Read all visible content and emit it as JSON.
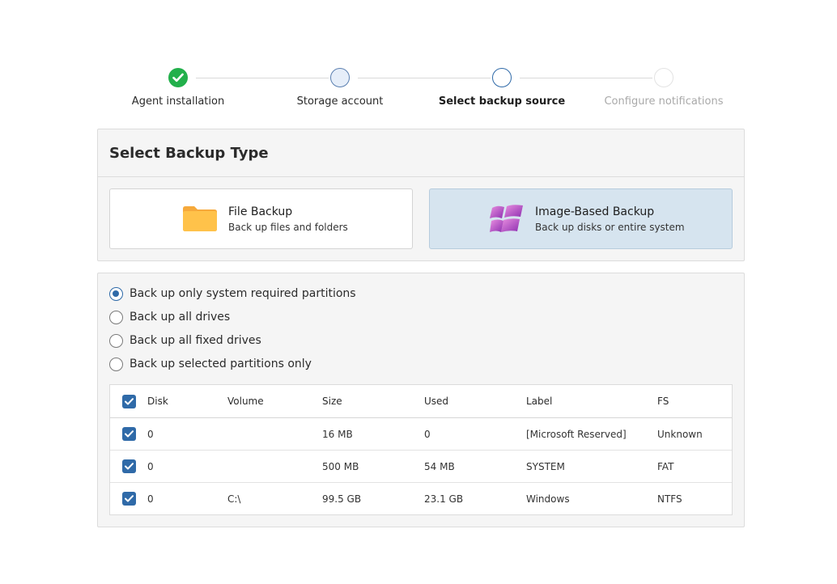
{
  "stepper": {
    "steps": [
      {
        "label": "Agent installation",
        "state": "done"
      },
      {
        "label": "Storage account",
        "state": "visited"
      },
      {
        "label": "Select backup source",
        "state": "current"
      },
      {
        "label": "Configure notifications",
        "state": "pending"
      }
    ]
  },
  "backup_type": {
    "title": "Select Backup Type",
    "options": [
      {
        "title": "File Backup",
        "description": "Back up files and folders",
        "icon": "folder-icon",
        "selected": false
      },
      {
        "title": "Image-Based Backup",
        "description": "Back up disks or entire system",
        "icon": "windows-logo-icon",
        "selected": true
      }
    ]
  },
  "partition_options": [
    {
      "label": "Back up only system required partitions",
      "selected": true
    },
    {
      "label": "Back up all drives",
      "selected": false
    },
    {
      "label": "Back up all fixed drives",
      "selected": false
    },
    {
      "label": "Back up selected partitions only",
      "selected": false
    }
  ],
  "table": {
    "columns": [
      "Disk",
      "Volume",
      "Size",
      "Used",
      "Label",
      "FS"
    ],
    "rows": [
      {
        "checked": true,
        "disk": "0",
        "volume": "",
        "size": "16 MB",
        "used": "0",
        "label": "[Microsoft Reserved]",
        "fs": "Unknown"
      },
      {
        "checked": true,
        "disk": "0",
        "volume": "",
        "size": "500 MB",
        "used": "54 MB",
        "label": "SYSTEM",
        "fs": "FAT"
      },
      {
        "checked": true,
        "disk": "0",
        "volume": "C:\\",
        "size": "99.5 GB",
        "used": "23.1 GB",
        "label": "Windows",
        "fs": "NTFS"
      }
    ]
  },
  "colors": {
    "accent": "#2f6aa8",
    "success": "#22b04b",
    "selected_card": "#d6e4ef"
  }
}
